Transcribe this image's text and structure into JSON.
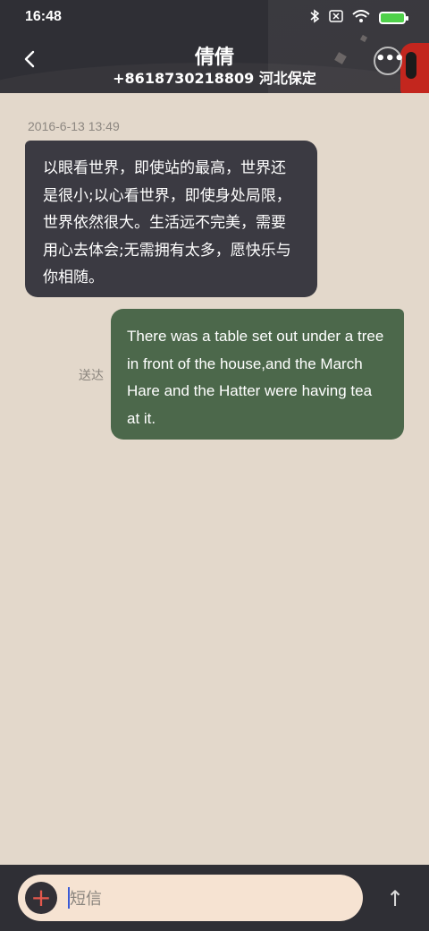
{
  "status_bar": {
    "time": "16:48",
    "icons": [
      "bluetooth-icon",
      "sim-off-icon",
      "wifi-icon",
      "battery-charging-icon"
    ]
  },
  "header": {
    "title": "倩倩",
    "subtitle": "+8618730218809 河北保定",
    "back_icon": "‹",
    "more_icon": "•••"
  },
  "messages": {
    "timestamp": "2016-6-13 13:49",
    "incoming": "以眼看世界，即使站的最高，世界还是很小;以心看世界，即使身处局限，世界依然很大。生活远不完美，需要用心去体会;无需拥有太多，愿快乐与你相随。",
    "outgoing": "There was a table set out under a tree in front of the house,and the March Hare and the Hatter were having tea at it.",
    "outgoing_status": "送达"
  },
  "composer": {
    "placeholder": "短信",
    "add_icon": "+",
    "send_icon": "↑"
  },
  "colors": {
    "background": "#e3d8cb",
    "header": "#2f2f35",
    "incoming_bubble": "#3b3a42",
    "outgoing_bubble": "#4c684b",
    "input": "#f6e3d2",
    "accent_red": "#e5584d"
  }
}
